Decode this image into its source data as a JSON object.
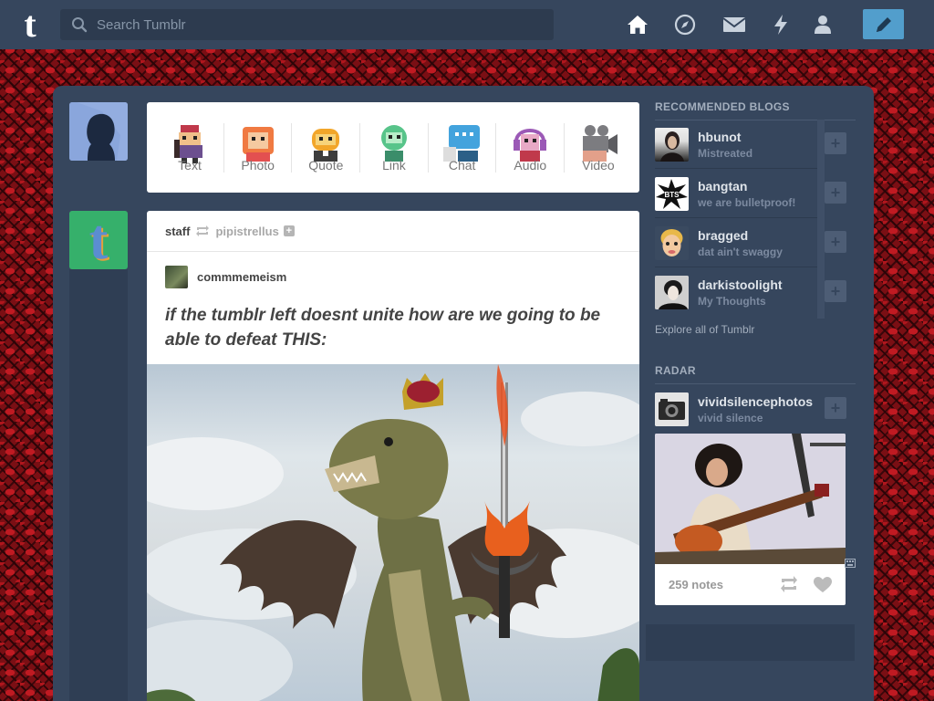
{
  "topbar": {
    "logo": "t",
    "search_placeholder": "Search Tumblr",
    "nav": [
      "home-icon",
      "explore-compass-icon",
      "inbox-mail-icon",
      "activity-lightning-icon",
      "account-person-icon"
    ],
    "compose_icon": "pencil-icon"
  },
  "post_types": [
    {
      "label": "Text",
      "color": "#c44"
    },
    {
      "label": "Photo",
      "color": "#f07a42"
    },
    {
      "label": "Quote",
      "color": "#f2a62a"
    },
    {
      "label": "Link",
      "color": "#58c48a"
    },
    {
      "label": "Chat",
      "color": "#43a3dd"
    },
    {
      "label": "Audio",
      "color": "#9b59b6"
    },
    {
      "label": "Video",
      "color": "#7c7c80"
    }
  ],
  "post": {
    "author": "staff",
    "source": "pipistrellus",
    "reblogger": "commmemeism",
    "title": "if the tumblr left doesnt unite how are we going to be able to defeat THIS:"
  },
  "recommended": {
    "heading": "RECOMMENDED BLOGS",
    "blogs": [
      {
        "name": "hbunot",
        "desc": "Mistreated"
      },
      {
        "name": "bangtan",
        "desc": "we are bulletproof!"
      },
      {
        "name": "bragged",
        "desc": "dat ain't swaggy"
      },
      {
        "name": "darkistoolight",
        "desc": "My Thoughts"
      }
    ],
    "explore": "Explore all of Tumblr"
  },
  "radar": {
    "heading": "RADAR",
    "blog_name": "vividsilencephotos",
    "blog_desc": "vivid silence",
    "notes": "259 notes"
  },
  "colors": {
    "topbar": "#36465d",
    "accent": "#529ecc",
    "background": "#7a0f14"
  }
}
